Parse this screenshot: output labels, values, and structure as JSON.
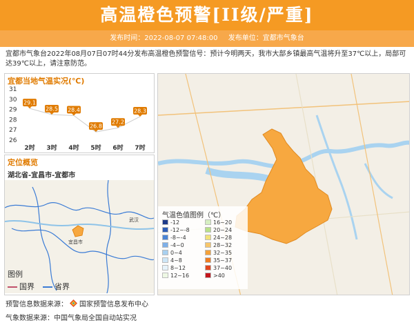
{
  "header": {
    "title": "高温橙色预警[II级/严重]",
    "publish_time": "发布时间：2022-08-07 07:48:00",
    "publish_unit": "发布单位：宜都市气象台"
  },
  "description": "宜都市气象台2022年08月07日07时44分发布高温橙色预警信号：预计今明两天，我市大部乡镇最高气温将升至37℃以上，局部可达39℃以上，请注意防范。",
  "temp_panel": {
    "title": "宜都当地气温实况(℃)",
    "y_ticks": [
      "31",
      "30",
      "29",
      "28",
      "27",
      "26"
    ]
  },
  "chart_data": {
    "type": "line",
    "title": "宜都当地气温实况(℃)",
    "categories": [
      "2时",
      "3时",
      "4时",
      "5时",
      "6时",
      "7时"
    ],
    "values": [
      29.1,
      28.5,
      28.4,
      26.8,
      27.2,
      28.3
    ],
    "ylim": [
      26,
      31
    ],
    "color": "#e07b00"
  },
  "loc_panel": {
    "title": "定位概览",
    "subtitle": "湖北省-宜昌市-宜都市",
    "legend_title": "图例",
    "legend_items": [
      {
        "label": "国界",
        "color": "#c0506a"
      },
      {
        "label": "省界",
        "color": "#3a7bd5"
      }
    ],
    "places": [
      "宜昌市",
      "武汉"
    ]
  },
  "map_legend": {
    "title": "气温色值图例（℃）",
    "items": [
      {
        "label": "-12",
        "color": "#1f3b8a"
      },
      {
        "label": "16~20",
        "color": "#d6efc2"
      },
      {
        "label": "-12~-8",
        "color": "#2f5fb8"
      },
      {
        "label": "20~24",
        "color": "#b9e08a"
      },
      {
        "label": "-8~-4",
        "color": "#4a85d6"
      },
      {
        "label": "24~28",
        "color": "#f2e27a"
      },
      {
        "label": "-4~0",
        "color": "#7fb0e8"
      },
      {
        "label": "28~32",
        "color": "#f7c66a"
      },
      {
        "label": "0~4",
        "color": "#a8d0f0"
      },
      {
        "label": "32~35",
        "color": "#f5a23a"
      },
      {
        "label": "4~8",
        "color": "#cde6f7"
      },
      {
        "label": "35~37",
        "color": "#ef7d22"
      },
      {
        "label": "8~12",
        "color": "#e6f3fb"
      },
      {
        "label": "37~40",
        "color": "#e2461e"
      },
      {
        "label": "12~16",
        "color": "#eef8e4"
      },
      {
        "label": ">40",
        "color": "#c4161c"
      }
    ]
  },
  "footer": {
    "warning_source": "预警信息数据来源：",
    "warning_source_name": "国家预警信息发布中心",
    "weather_source": "气象数据来源：中国气象局全国自动站实况"
  },
  "colors": {
    "banner": "#f59a23",
    "accent": "#e07b00",
    "warning_area": "#f7a840"
  }
}
